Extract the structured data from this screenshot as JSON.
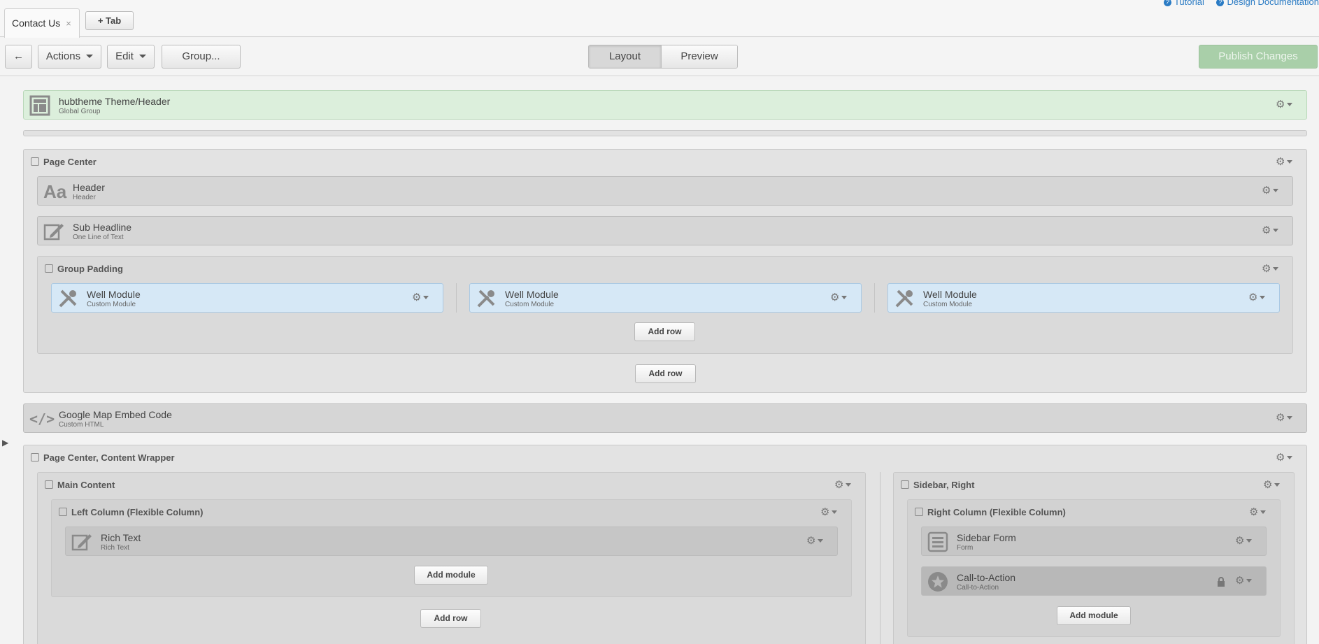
{
  "tabs": {
    "active": "Contact Us",
    "close": "×",
    "add": "+ Tab"
  },
  "toplinks": {
    "tutorial": "Tutorial",
    "design_docs": "Design Documentation"
  },
  "toolbar": {
    "back": "←",
    "actions": "Actions",
    "edit": "Edit",
    "group": "Group...",
    "layout": "Layout",
    "preview": "Preview",
    "publish": "Publish Changes"
  },
  "header_group": {
    "title": "hubtheme Theme/Header",
    "sub": "Global Group"
  },
  "page_center": {
    "title": "Page Center",
    "header": {
      "title": "Header",
      "sub": "Header"
    },
    "subheadline": {
      "title": "Sub Headline",
      "sub": "One Line of Text"
    },
    "group_padding": {
      "title": "Group Padding",
      "wells": [
        {
          "title": "Well Module",
          "sub": "Custom Module"
        },
        {
          "title": "Well Module",
          "sub": "Custom Module"
        },
        {
          "title": "Well Module",
          "sub": "Custom Module"
        }
      ],
      "add_row": "Add row"
    },
    "add_row": "Add row"
  },
  "google_map": {
    "title": "Google Map Embed Code",
    "sub": "Custom HTML"
  },
  "content_wrapper": {
    "title": "Page Center, Content Wrapper",
    "main": {
      "title": "Main Content",
      "left_col": {
        "title": "Left Column (Flexible Column)",
        "rich_text": {
          "title": "Rich Text",
          "sub": "Rich Text"
        },
        "add_module": "Add module"
      },
      "add_row": "Add row"
    },
    "sidebar": {
      "title": "Sidebar, Right",
      "right_col": {
        "title": "Right Column (Flexible Column)",
        "form": {
          "title": "Sidebar Form",
          "sub": "Form"
        },
        "cta": {
          "title": "Call-to-Action",
          "sub": "Call-to-Action"
        },
        "add_module": "Add module"
      }
    }
  },
  "colors": {
    "green": "#dcefdc",
    "blue": "#d6e8f6",
    "link": "#2a7bc4"
  }
}
